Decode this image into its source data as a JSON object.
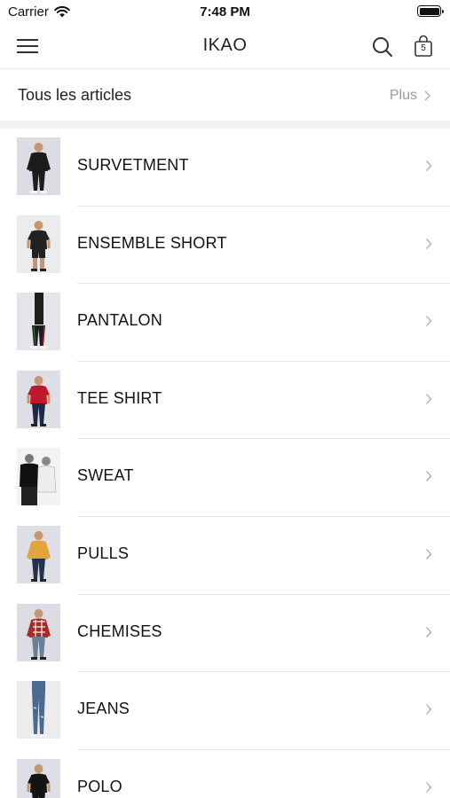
{
  "status_bar": {
    "carrier": "Carrier",
    "time": "7:48 PM"
  },
  "nav": {
    "title": "IKAO",
    "cart_count": "5"
  },
  "all_articles": {
    "label": "Tous les articles",
    "more_label": "Plus"
  },
  "categories": [
    {
      "label": "SURVETMENT",
      "thumb": "tracksuit",
      "bg": "#dcdce4"
    },
    {
      "label": "ENSEMBLE SHORT",
      "thumb": "shorts-set",
      "bg": "#ececef"
    },
    {
      "label": "PANTALON",
      "thumb": "pants",
      "bg": "#e4e4ea"
    },
    {
      "label": "TEE SHIRT",
      "thumb": "tee",
      "bg": "#dedee6"
    },
    {
      "label": "SWEAT",
      "thumb": "sweat",
      "bg": "#f2f2f2"
    },
    {
      "label": "PULLS",
      "thumb": "pullover",
      "bg": "#dedee6"
    },
    {
      "label": "CHEMISES",
      "thumb": "shirt",
      "bg": "#dcdce4"
    },
    {
      "label": "JEANS",
      "thumb": "jeans",
      "bg": "#ececef"
    },
    {
      "label": "POLO",
      "thumb": "polo",
      "bg": "#dedee6"
    }
  ]
}
